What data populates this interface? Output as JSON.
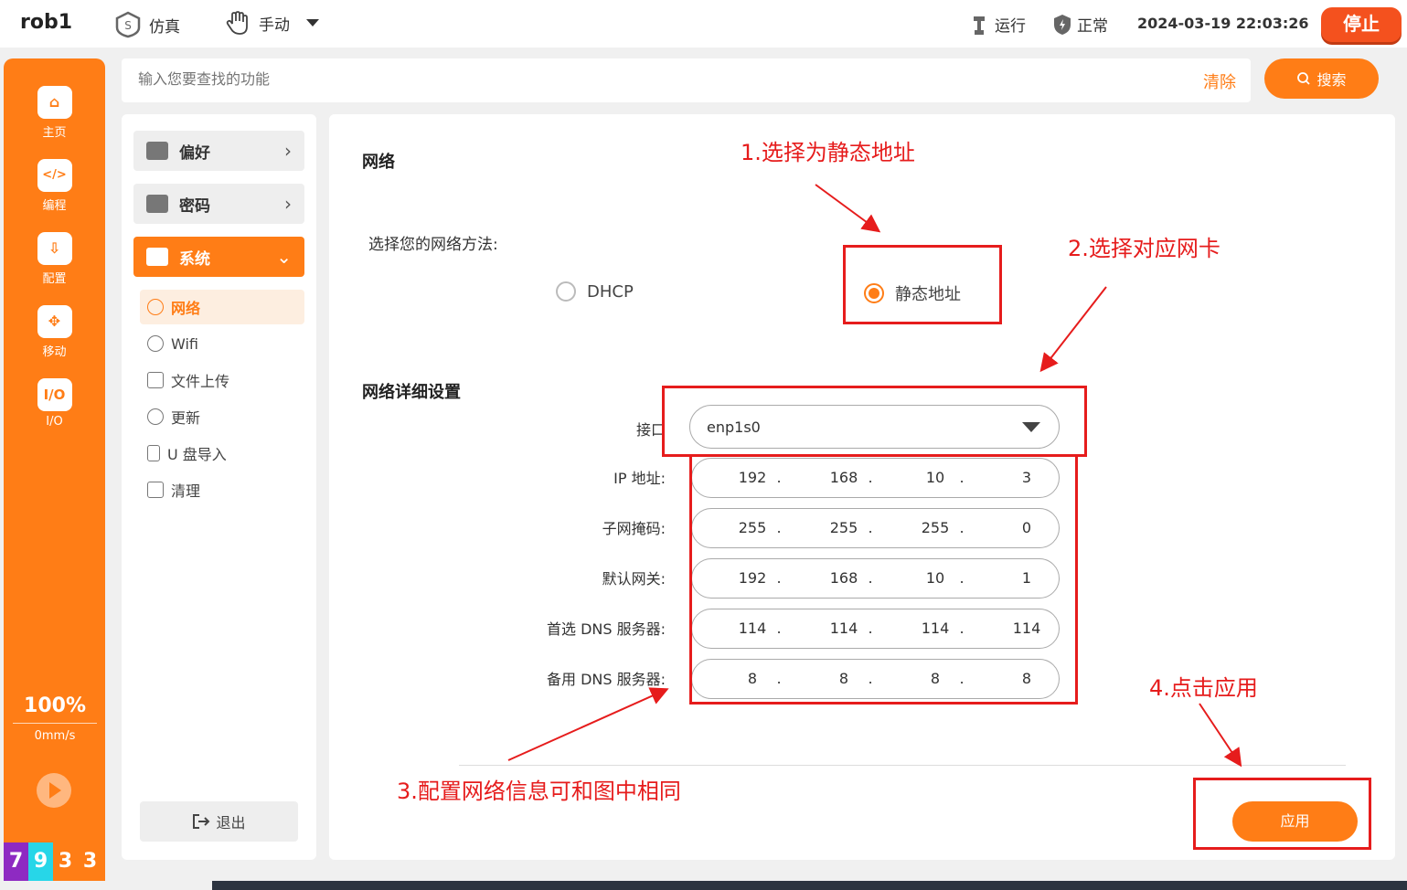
{
  "topbar": {
    "robot_name": "rob1",
    "sim_label": "仿真",
    "manual_label": "手动",
    "run_label": "运行",
    "status_label": "正常",
    "datetime": "2024-03-19 22:03:26",
    "stop_label": "停止"
  },
  "rail": {
    "items": [
      {
        "label": "主页",
        "glyph": "⌂"
      },
      {
        "label": "编程",
        "glyph": "</>"
      },
      {
        "label": "配置",
        "glyph": "⇩"
      },
      {
        "label": "移动",
        "glyph": "✥"
      },
      {
        "label": "I/O",
        "glyph": "I/O"
      }
    ],
    "speed_pct": "100%",
    "speed_value": "0mm/s",
    "digits": [
      {
        "text": "7",
        "color": "#8e2ac2"
      },
      {
        "text": "9",
        "color": "#27d6e8"
      },
      {
        "text": "3",
        "color": "#ff7d16"
      },
      {
        "text": "3",
        "color": "#ff7d16"
      }
    ]
  },
  "search": {
    "placeholder": "输入您要查找的功能",
    "clear_label": "清除",
    "button_label": "搜索"
  },
  "side_menu": {
    "cards": [
      {
        "label": "偏好",
        "chevron": "›"
      },
      {
        "label": "密码",
        "chevron": "›"
      },
      {
        "label": "系统",
        "chevron": "⌄"
      }
    ],
    "sub_items": [
      "网络",
      "Wifi",
      "文件上传",
      "更新",
      "U 盘导入",
      "清理"
    ],
    "logout_label": "退出"
  },
  "main": {
    "network_title": "网络",
    "method_label": "选择您的网络方法:",
    "radio_dhcp": "DHCP",
    "radio_static": "静态地址",
    "detail_title": "网络详细设置",
    "interface_label": "接口",
    "interface_value": "enp1s0",
    "rows": [
      {
        "label": "IP 地址:",
        "octets": [
          "192",
          "168",
          "10",
          "3"
        ]
      },
      {
        "label": "子网掩码:",
        "octets": [
          "255",
          "255",
          "255",
          "0"
        ]
      },
      {
        "label": "默认网关:",
        "octets": [
          "192",
          "168",
          "10",
          "1"
        ]
      },
      {
        "label": "首选 DNS 服务器:",
        "octets": [
          "114",
          "114",
          "114",
          "114"
        ]
      },
      {
        "label": "备用 DNS 服务器:",
        "octets": [
          "8",
          "8",
          "8",
          "8"
        ]
      }
    ],
    "apply_label": "应用"
  },
  "annotations": {
    "step1": "1.选择为静态地址",
    "step2": "2.选择对应网卡",
    "step3": "3.配置网络信息可和图中相同",
    "step4": "4.点击应用"
  },
  "colors": {
    "accent": "#ff7d16",
    "stop": "#f4511e",
    "annotation": "#e61c1c"
  }
}
